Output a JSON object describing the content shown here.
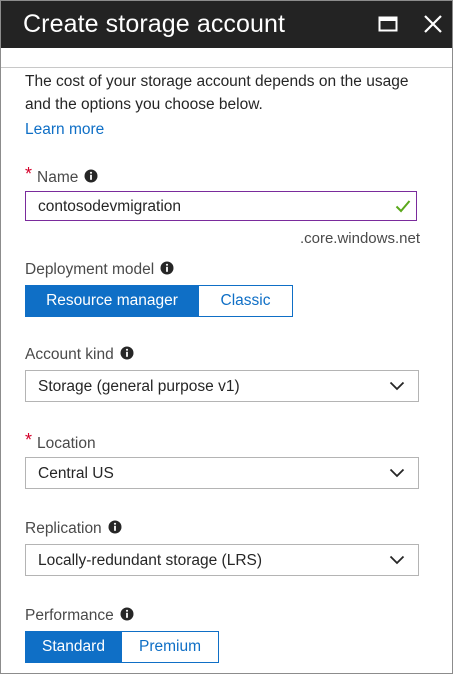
{
  "window": {
    "title": "Create storage account",
    "maximize_icon": "maximize-icon",
    "close_icon": "close-icon"
  },
  "intro": {
    "description": "The cost of your storage account depends on the usage and the options you choose below.",
    "learn_more": "Learn more"
  },
  "name_field": {
    "label": "Name",
    "required_mark": "*",
    "value": "contosodevmigration",
    "suffix": ".core.windows.net",
    "valid": true
  },
  "deployment_model": {
    "label": "Deployment model",
    "options": [
      "Resource manager",
      "Classic"
    ],
    "selected": "Resource manager"
  },
  "account_kind": {
    "label": "Account kind",
    "value": "Storage (general purpose v1)"
  },
  "location": {
    "label": "Location",
    "required_mark": "*",
    "value": "Central US"
  },
  "replication": {
    "label": "Replication",
    "value": "Locally-redundant storage (LRS)"
  },
  "performance": {
    "label": "Performance",
    "options": [
      "Standard",
      "Premium"
    ],
    "selected": "Standard"
  },
  "colors": {
    "title_bar": "#232323",
    "accent": "#0f6fc6",
    "required": "#d4002a",
    "valid_check": "#5aa81b",
    "input_focus_border": "#7a2b9c"
  }
}
